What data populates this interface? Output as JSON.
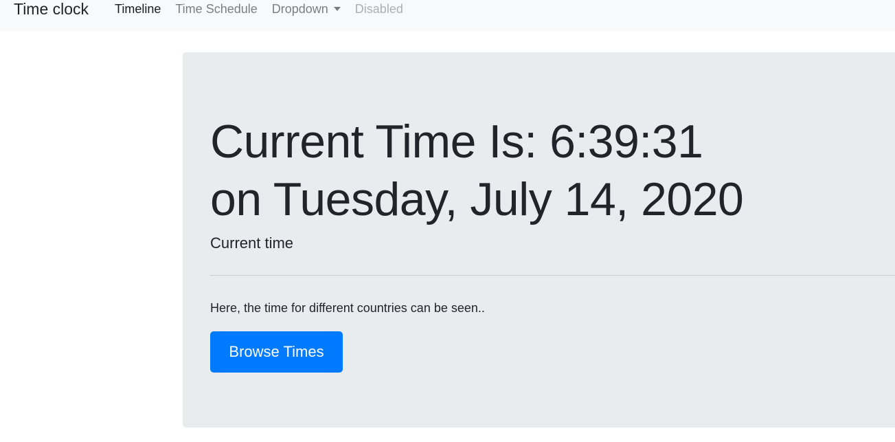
{
  "navbar": {
    "brand": "Time clock",
    "links": [
      {
        "label": "Timeline",
        "state": "active"
      },
      {
        "label": "Time Schedule",
        "state": "normal"
      },
      {
        "label": "Dropdown",
        "state": "normal"
      },
      {
        "label": "Disabled",
        "state": "disabled"
      }
    ]
  },
  "jumbotron": {
    "heading_line1": "Current Time Is: 6:39:31",
    "heading_line2": "on Tuesday, July 14, 2020",
    "lead": "Current time",
    "body": "Here, the time for different countries can be seen..",
    "button_label": "Browse Times"
  },
  "colors": {
    "navbar_bg": "#f8f9fa",
    "jumbotron_bg": "#e9ecef",
    "primary": "#007bff",
    "text": "#212529"
  }
}
